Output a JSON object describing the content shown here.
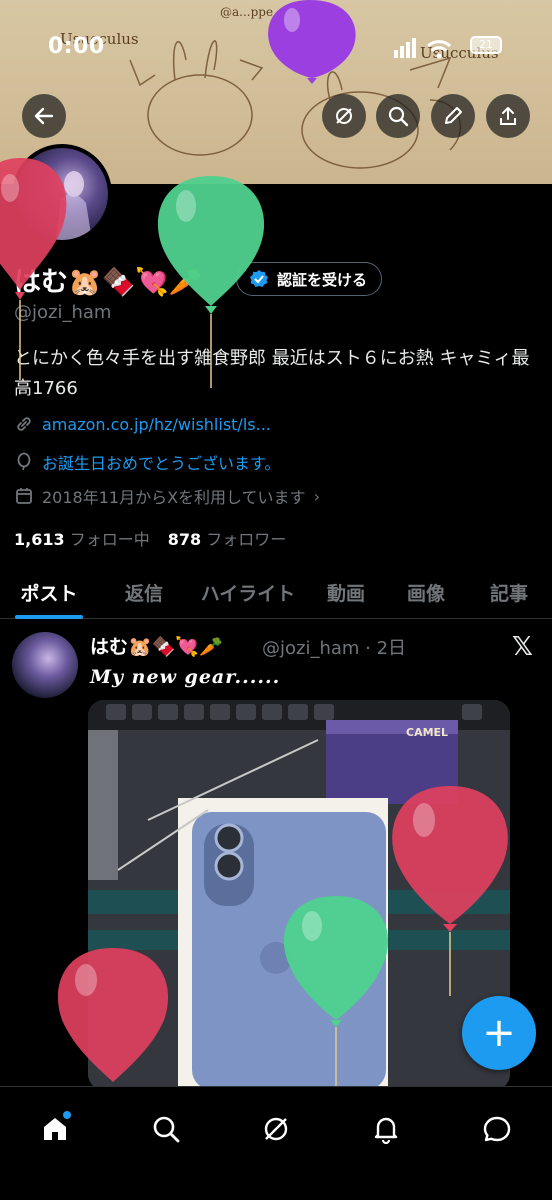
{
  "status_bar": {
    "time": "0:00",
    "battery": "21"
  },
  "banner": {
    "sketch_text_left": "Usucculus",
    "sketch_text_right": "Usucculus",
    "sketch_signature": "@a...ppe"
  },
  "header_buttons": [
    "back-arrow-icon",
    "grok-icon",
    "search-icon",
    "edit-icon",
    "share-icon"
  ],
  "profile": {
    "name": "はむ🐹🍫💘🥕",
    "handle": "@jozi_ham",
    "verify_label": "認証を受ける",
    "bio": "とにかく色々手を出す雑食野郎 最近はスト６にお熱 キャミィ最高1766",
    "website": "amazon.co.jp/hz/wishlist/ls...",
    "birthday": "お誕生日おめでとうございます。",
    "joined": "2018年11月からXを利用しています",
    "following_count": "1,613",
    "following_label": "フォロー中",
    "followers_count": "878",
    "followers_label": "フォロワー"
  },
  "tabs": [
    {
      "label": "ポスト",
      "active": true
    },
    {
      "label": "返信",
      "active": false
    },
    {
      "label": "ハイライト",
      "active": false
    },
    {
      "label": "動画",
      "active": false
    },
    {
      "label": "画像",
      "active": false
    },
    {
      "label": "記事",
      "active": false
    }
  ],
  "post": {
    "name": "はむ🐹🍫💘🥕",
    "handle_time": "@jozi_ham · 2日",
    "x_mark": "𝕏",
    "text": "My new gear......",
    "photo_box_label": "CAMEL"
  },
  "fab_label": "+",
  "bottom_nav": [
    "home-icon",
    "search-icon",
    "grok-icon",
    "notifications-icon",
    "messages-icon"
  ],
  "colors": {
    "accent": "#1d9bf0",
    "background": "#000000",
    "muted": "#71767b",
    "balloon_red": "#e0405e",
    "balloon_green": "#4fd18e",
    "balloon_purple": "#9b3fe0"
  }
}
